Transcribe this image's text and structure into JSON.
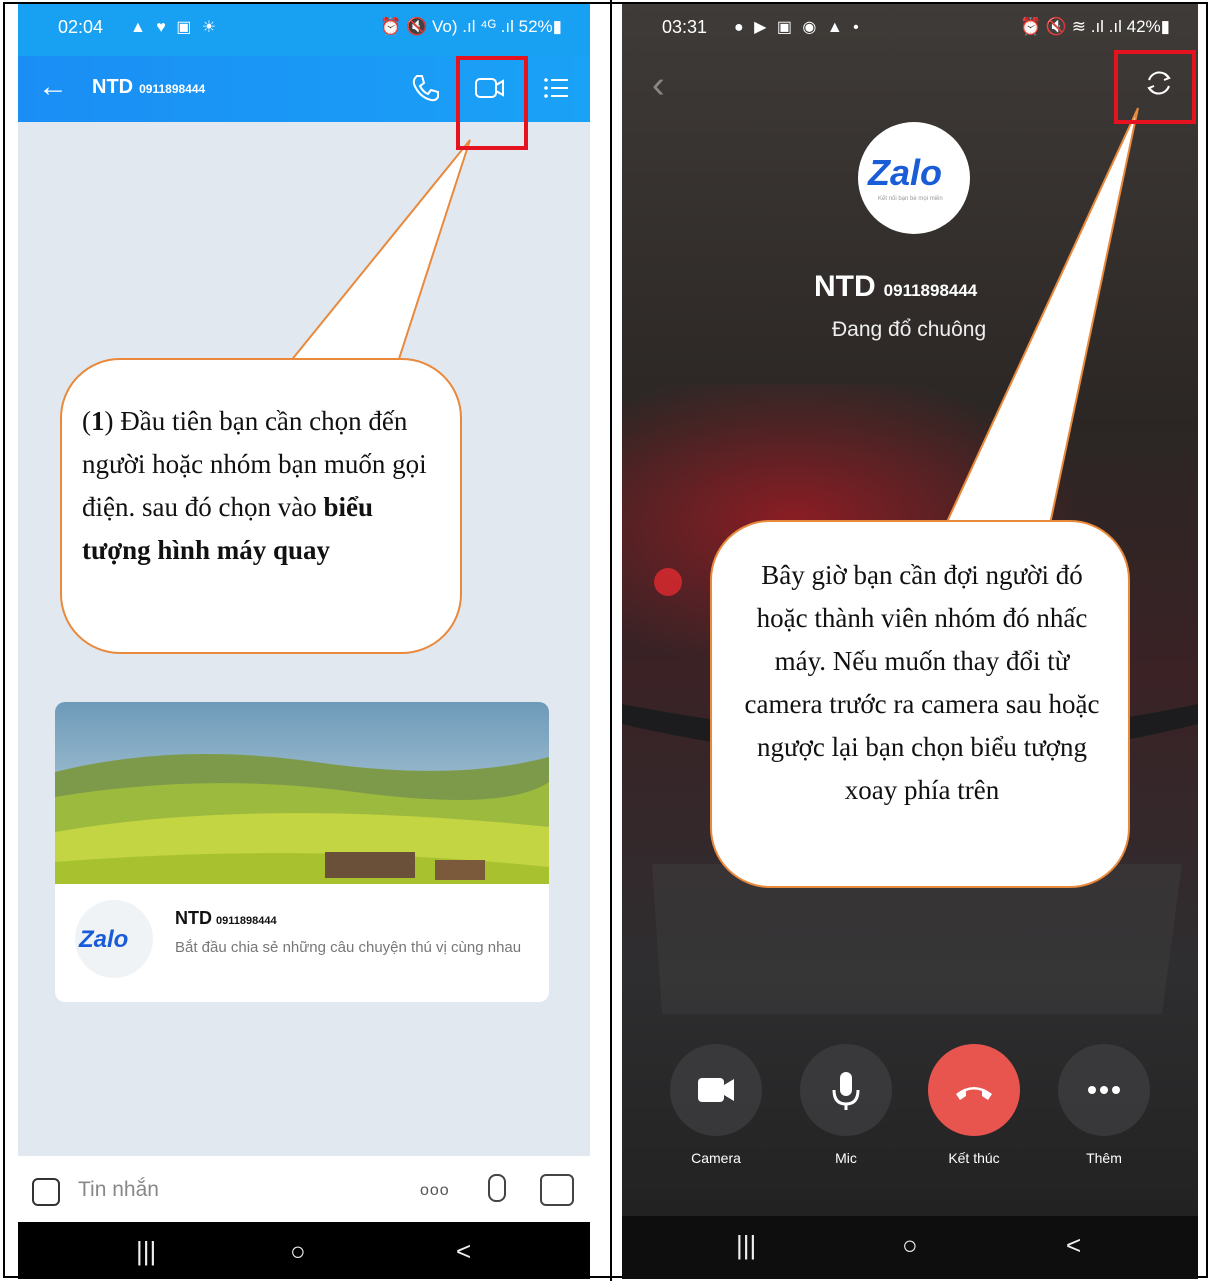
{
  "left": {
    "status": {
      "time": "02:04",
      "icons_left": "▲ ♥ ▣ ☀",
      "icons_right": "⏰ 🔇 Vo) .ıl ⁴ᴳ .ıl 52%▮"
    },
    "header": {
      "name": "NTD",
      "phone": "0911898444"
    },
    "card": {
      "title": "NTD",
      "phone": "0911898444",
      "description": "Bắt đầu chia sẻ những câu chuyện thú vị cùng nhau",
      "logo": "Zalo"
    },
    "input": {
      "placeholder": "Tin nhắn",
      "more": "ooo"
    },
    "callout": {
      "num": "1",
      "text_a": " Đầu tiên bạn cần chọn đến người hoặc nhóm bạn muốn gọi điện. sau đó chọn vào ",
      "text_bold": "biểu tượng hình máy quay"
    }
  },
  "right": {
    "status": {
      "time": "03:31",
      "icons_left": "● ▶ ▣ ◉ ▲ •",
      "icons_right": "⏰ 🔇 ≋ .ıl .ıl 42%▮"
    },
    "logo": "Zalo",
    "logo_tag": "Kết nối bạn bè mọi miền",
    "caller": {
      "name": "NTD",
      "phone": "0911898444"
    },
    "call_status": "Đang đổ chuông",
    "buttons": [
      {
        "label": "Camera",
        "icon": "camera-icon"
      },
      {
        "label": "Mic",
        "icon": "mic-icon"
      },
      {
        "label": "Kết thúc",
        "icon": "end-call-icon"
      },
      {
        "label": "Thêm",
        "icon": "more-icon"
      }
    ],
    "callout": {
      "text": "Bây giờ bạn cần đợi người đó hoặc thành viên nhóm đó nhấc máy. Nếu muốn thay đổi từ camera trước ra camera sau hoặc ngược lại bạn chọn biểu tượng xoay phía trên"
    }
  },
  "nav": {
    "recent": "|||",
    "home": "○",
    "back": "<"
  },
  "colors": {
    "zalo_blue": "#1a8ef5",
    "highlight_red": "#e4131f",
    "callout_border": "#e8893c",
    "end_call": "#e8554f"
  }
}
